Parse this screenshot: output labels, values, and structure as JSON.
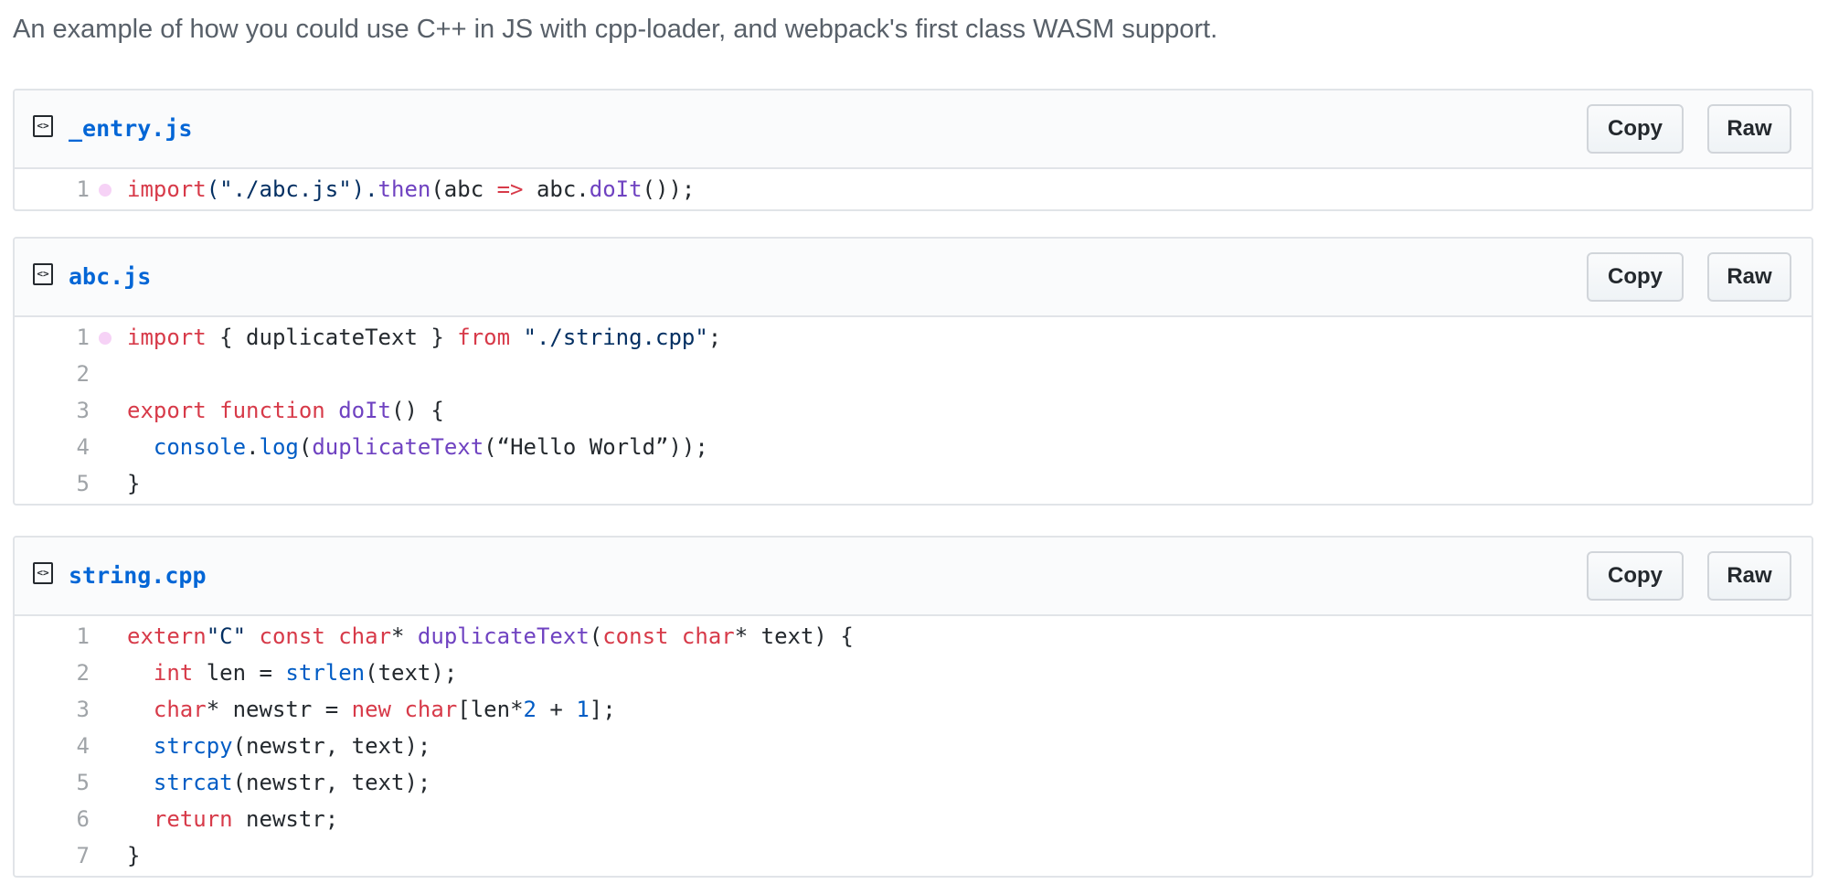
{
  "description": "An example of how you could use C++ in JS with cpp-loader, and webpack's first class WASM support.",
  "icon_names": {
    "file_icon": "code-file-icon"
  },
  "colors": {
    "keyword": "#d73a49",
    "function": "#6f42c1",
    "string": "#032f62",
    "constant": "#005cc5",
    "plain": "#24292e",
    "filename": "#0366d6",
    "line_number": "#a0a4a8",
    "marker_dot": "#f6d2f6"
  },
  "files": [
    {
      "name": "_entry.js",
      "copy_label": "Copy",
      "raw_label": "Raw",
      "lines": [
        {
          "number": "1",
          "dot": true,
          "tokens": [
            {
              "t": "import",
              "c": "k"
            },
            {
              "t": "(\"./abc.js\").",
              "c": "s"
            },
            {
              "t": "then",
              "c": "f"
            },
            {
              "t": "(abc ",
              "c": "p"
            },
            {
              "t": "=>",
              "c": "k"
            },
            {
              "t": " abc.",
              "c": "p"
            },
            {
              "t": "doIt",
              "c": "f"
            },
            {
              "t": "());",
              "c": "p"
            }
          ]
        }
      ]
    },
    {
      "name": "abc.js",
      "copy_label": "Copy",
      "raw_label": "Raw",
      "lines": [
        {
          "number": "1",
          "dot": true,
          "tokens": [
            {
              "t": "import",
              "c": "k"
            },
            {
              "t": " { duplicateText } ",
              "c": "p"
            },
            {
              "t": "from",
              "c": "k"
            },
            {
              "t": " \"./string.cpp\"",
              "c": "s"
            },
            {
              "t": ";",
              "c": "p"
            }
          ]
        },
        {
          "number": "2",
          "dot": false,
          "tokens": []
        },
        {
          "number": "3",
          "dot": false,
          "tokens": [
            {
              "t": "export",
              "c": "k"
            },
            {
              "t": " ",
              "c": "p"
            },
            {
              "t": "function",
              "c": "k"
            },
            {
              "t": " ",
              "c": "p"
            },
            {
              "t": "doIt",
              "c": "f"
            },
            {
              "t": "() {",
              "c": "p"
            }
          ]
        },
        {
          "number": "4",
          "dot": false,
          "tokens": [
            {
              "t": "  ",
              "c": "p"
            },
            {
              "t": "console",
              "c": "c"
            },
            {
              "t": ".",
              "c": "p"
            },
            {
              "t": "log",
              "c": "c"
            },
            {
              "t": "(",
              "c": "p"
            },
            {
              "t": "duplicateText",
              "c": "f"
            },
            {
              "t": "(“Hello World”));",
              "c": "p"
            }
          ]
        },
        {
          "number": "5",
          "dot": false,
          "tokens": [
            {
              "t": "}",
              "c": "p"
            }
          ]
        }
      ]
    },
    {
      "name": "string.cpp",
      "copy_label": "Copy",
      "raw_label": "Raw",
      "lines": [
        {
          "number": "1",
          "dot": false,
          "tokens": [
            {
              "t": "extern",
              "c": "k"
            },
            {
              "t": "\"C\"",
              "c": "s"
            },
            {
              "t": " ",
              "c": "p"
            },
            {
              "t": "const",
              "c": "k"
            },
            {
              "t": " ",
              "c": "p"
            },
            {
              "t": "char",
              "c": "k"
            },
            {
              "t": "* ",
              "c": "p"
            },
            {
              "t": "duplicateText",
              "c": "f"
            },
            {
              "t": "(",
              "c": "p"
            },
            {
              "t": "const",
              "c": "k"
            },
            {
              "t": " ",
              "c": "p"
            },
            {
              "t": "char",
              "c": "k"
            },
            {
              "t": "* text) {",
              "c": "p"
            }
          ]
        },
        {
          "number": "2",
          "dot": false,
          "tokens": [
            {
              "t": "  ",
              "c": "p"
            },
            {
              "t": "int",
              "c": "k"
            },
            {
              "t": " len = ",
              "c": "p"
            },
            {
              "t": "strlen",
              "c": "c"
            },
            {
              "t": "(text);",
              "c": "p"
            }
          ]
        },
        {
          "number": "3",
          "dot": false,
          "tokens": [
            {
              "t": "  ",
              "c": "p"
            },
            {
              "t": "char",
              "c": "k"
            },
            {
              "t": "* newstr = ",
              "c": "p"
            },
            {
              "t": "new",
              "c": "k"
            },
            {
              "t": " ",
              "c": "p"
            },
            {
              "t": "char",
              "c": "k"
            },
            {
              "t": "[len*",
              "c": "p"
            },
            {
              "t": "2",
              "c": "c"
            },
            {
              "t": " + ",
              "c": "p"
            },
            {
              "t": "1",
              "c": "c"
            },
            {
              "t": "];",
              "c": "p"
            }
          ]
        },
        {
          "number": "4",
          "dot": false,
          "tokens": [
            {
              "t": "  ",
              "c": "p"
            },
            {
              "t": "strcpy",
              "c": "c"
            },
            {
              "t": "(newstr, text);",
              "c": "p"
            }
          ]
        },
        {
          "number": "5",
          "dot": false,
          "tokens": [
            {
              "t": "  ",
              "c": "p"
            },
            {
              "t": "strcat",
              "c": "c"
            },
            {
              "t": "(newstr, text);",
              "c": "p"
            }
          ]
        },
        {
          "number": "6",
          "dot": false,
          "tokens": [
            {
              "t": "  ",
              "c": "p"
            },
            {
              "t": "return",
              "c": "k"
            },
            {
              "t": " newstr;",
              "c": "p"
            }
          ]
        },
        {
          "number": "7",
          "dot": false,
          "tokens": [
            {
              "t": "}",
              "c": "p"
            }
          ]
        }
      ]
    }
  ]
}
